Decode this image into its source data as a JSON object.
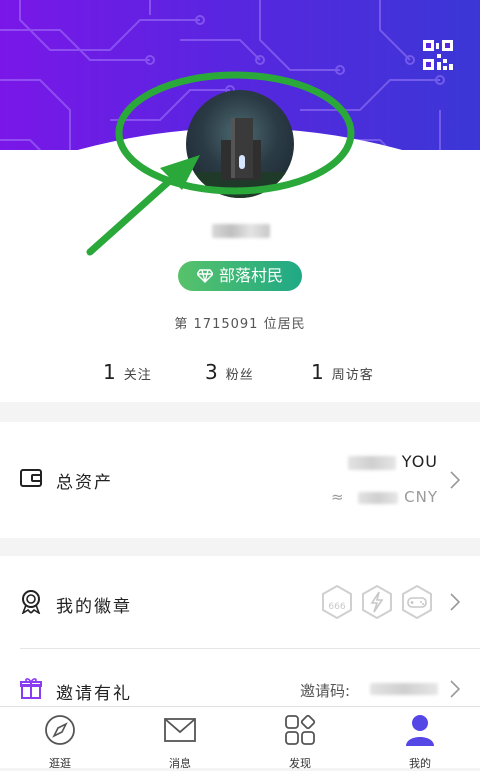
{
  "profile": {
    "username": "■■■■",
    "level_badge": "部落村民",
    "resident_rank": "第 1715091 位居民",
    "stats": [
      {
        "num": "1",
        "label": "关注"
      },
      {
        "num": "3",
        "label": "粉丝"
      },
      {
        "num": "1",
        "label": "周访客"
      }
    ]
  },
  "assets": {
    "label": "总资产",
    "you_value": "■■",
    "you_unit": "YOU",
    "approx": "≈",
    "cny_value": "■■■",
    "cny_unit": "CNY"
  },
  "badges": {
    "label": "我的徽章"
  },
  "invite": {
    "label": "邀请有礼",
    "code_label": "邀请码:",
    "code_value": "■■■■■"
  },
  "tabs": [
    {
      "label": "逛逛",
      "icon": "compass-icon"
    },
    {
      "label": "消息",
      "icon": "envelope-icon"
    },
    {
      "label": "发现",
      "icon": "discover-grid-icon"
    },
    {
      "label": "我的",
      "icon": "person-icon"
    }
  ],
  "colors": {
    "header_gradient_start": "#7a17e8",
    "header_gradient_end": "#3b37d6",
    "badge_green": "#3db87a",
    "annotation_green": "#2aa83a",
    "active_tab": "#5546e6"
  }
}
